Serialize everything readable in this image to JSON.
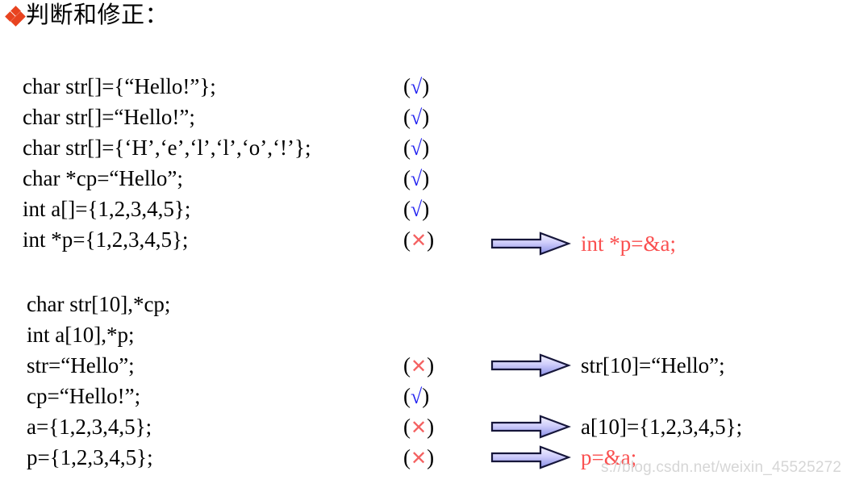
{
  "slide": {
    "title": "判断和修正：",
    "bullet_icon": "diamond-cluster-bullet",
    "bullet_color": "#E8431F",
    "background": "#ffffff"
  },
  "markers": {
    "correct": "√",
    "incorrect": "×",
    "open_paren": "(",
    "close_paren": ")",
    "correct_color": "#1c1cf0",
    "incorrect_color": "#f46161"
  },
  "arrow": {
    "icon": "right-block-arrow-icon",
    "outline_color": "#1a1a3c",
    "gradient_start": "#eceaff",
    "gradient_end": "#8f94e8"
  },
  "code_block_1": {
    "rows": [
      {
        "code": "char  str[]={“Hello!”};",
        "mark": "correct",
        "correction": null
      },
      {
        "code": "char  str[]=“Hello!”;",
        "mark": "correct",
        "correction": null
      },
      {
        "code": "char  str[]={‘H’,‘e’,‘l’,‘l’,‘o’,‘!’};",
        "mark": "correct",
        "correction": null
      },
      {
        "code": "char  *cp=“Hello”;",
        "mark": "correct",
        "correction": null
      },
      {
        "code": "int  a[]={1,2,3,4,5};",
        "mark": "correct",
        "correction": null
      },
      {
        "code": "int  *p={1,2,3,4,5};",
        "mark": "incorrect",
        "correction": "int   *p=&a;",
        "correction_color": "red"
      }
    ]
  },
  "code_block_2": {
    "rows": [
      {
        "code": "char  str[10],*cp;",
        "mark": null,
        "correction": null
      },
      {
        "code": "int  a[10],*p;",
        "mark": null,
        "correction": null
      },
      {
        "code": "str=“Hello”;",
        "mark": "incorrect",
        "correction": "str[10]=“Hello”;",
        "correction_color": "black"
      },
      {
        "code": "cp=“Hello!”;",
        "mark": "correct",
        "correction": null
      },
      {
        "code": "a={1,2,3,4,5};",
        "mark": "incorrect",
        "correction": "a[10]={1,2,3,4,5};",
        "correction_color": "black"
      },
      {
        "code": "p={1,2,3,4,5};",
        "mark": "incorrect",
        "correction": "p=&a;",
        "correction_color": "red"
      }
    ]
  },
  "watermark": {
    "text": "s://blog.csdn.net/weixin_45525272"
  }
}
